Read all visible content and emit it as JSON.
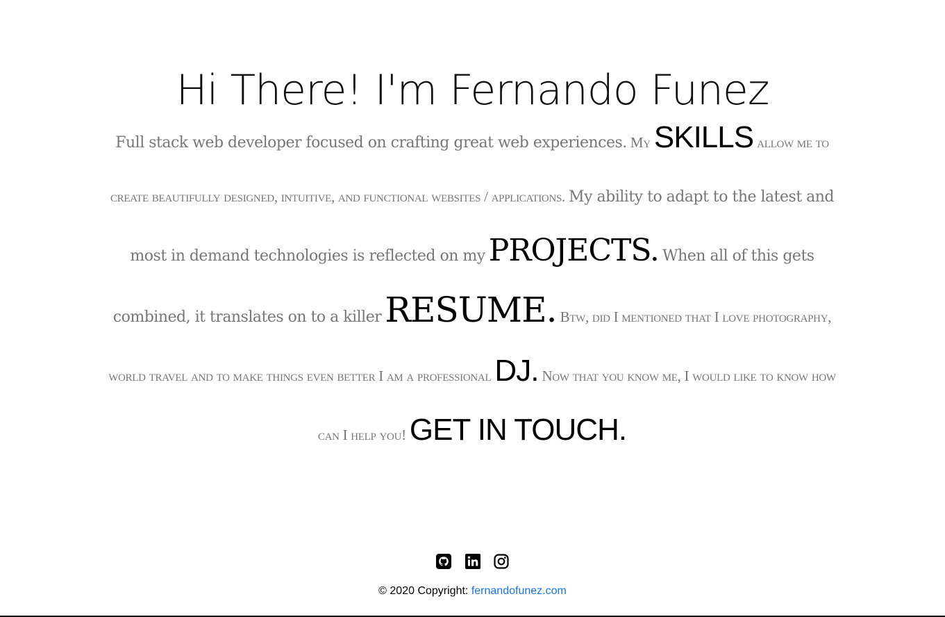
{
  "header": {
    "title": "Hi There! I'm Fernando Funez"
  },
  "intro": {
    "part1": "Full stack web developer focused on crafting great web experiences.",
    "part2": "My",
    "skills_link": "SKILLS",
    "part3": "allow me to create beautifully designed, intuitive, and functional websites / applications.",
    "part4": "My ability to adapt to the latest and most in demand technologies is reflected on my",
    "projects_link": "PROJECTS.",
    "part5": "When all of this gets combined, it translates on to a killer",
    "resume_link": "RESUME.",
    "part6": "Btw, did I mentioned that I love photography, world travel and to make things even better I am a professional",
    "dj_link": "DJ.",
    "part7": "Now that you know me, I would like to know how can I help you!",
    "contact_link": "GET IN TOUCH."
  },
  "social": {
    "icons": [
      "github-icon",
      "linkedin-icon",
      "instagram-icon"
    ]
  },
  "footer": {
    "copyright_prefix": "© 2020 Copyright:",
    "site_link": "fernandofunez.com"
  },
  "colors": {
    "link_blue": "#1a73e8",
    "body_gray": "#777777"
  }
}
